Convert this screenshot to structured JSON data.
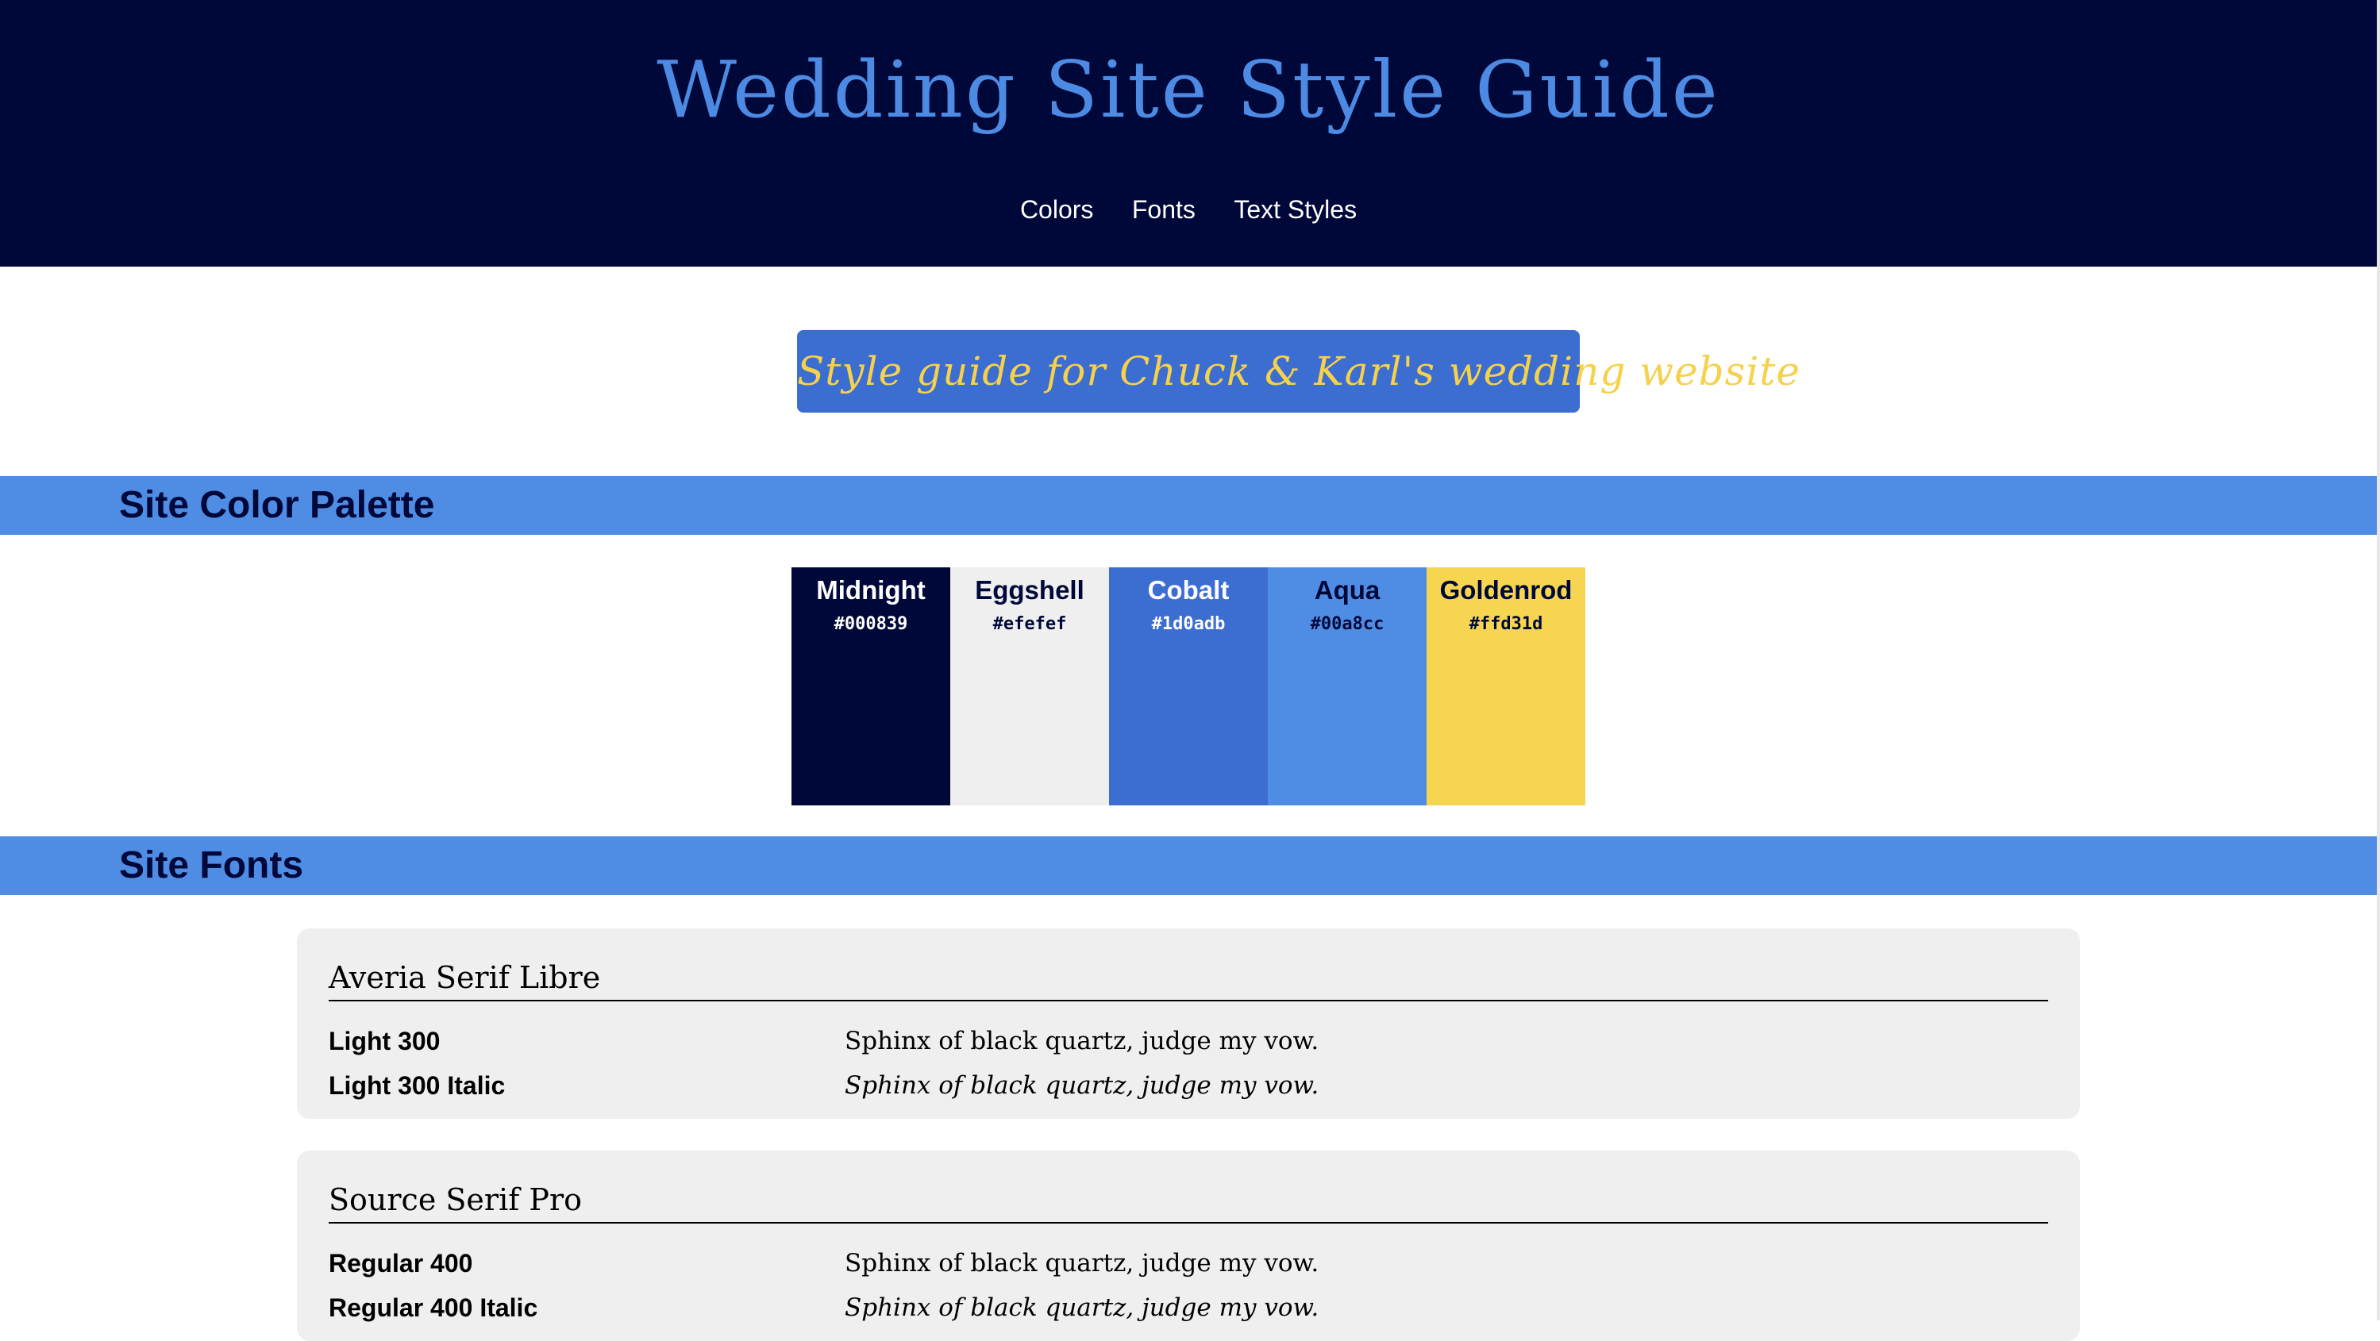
{
  "header": {
    "title": "Wedding Site Style Guide",
    "nav": [
      "Colors",
      "Fonts",
      "Text Styles"
    ]
  },
  "tagline": "Style guide for Chuck & Karl's wedding website",
  "sections": {
    "palette_title": "Site Color Palette",
    "fonts_title": "Site Fonts"
  },
  "palette": [
    {
      "name": "Midnight",
      "hex": "#000839",
      "text_color": "#ffffff"
    },
    {
      "name": "Eggshell",
      "hex": "#efefef",
      "text_color": "#000839"
    },
    {
      "name": "Cobalt",
      "hex": "#1d0adb",
      "text_color": "#ffffff"
    },
    {
      "name": "Aqua",
      "hex": "#00a8cc",
      "text_color": "#000839"
    },
    {
      "name": "Goldenrod",
      "hex": "#ffd31d",
      "text_color": "#000839"
    }
  ],
  "swatch_display_colors": [
    "#000839",
    "#efefef",
    "#3c6dd0",
    "#4f8ce4",
    "#f6d650"
  ],
  "fonts": [
    {
      "family": "Averia Serif Libre",
      "styles": [
        {
          "label": "Light 300",
          "sample": "Sphinx of black quartz, judge my vow.",
          "italic": false
        },
        {
          "label": "Light 300 Italic",
          "sample": "Sphinx of black quartz, judge my vow.",
          "italic": true
        }
      ]
    },
    {
      "family": "Source Serif Pro",
      "styles": [
        {
          "label": "Regular 400",
          "sample": "Sphinx of black quartz, judge my vow.",
          "italic": false
        },
        {
          "label": "Regular 400 Italic",
          "sample": "Sphinx of black quartz, judge my vow.",
          "italic": true
        }
      ]
    }
  ],
  "colors": {
    "header_bg": "#000839",
    "title": "#4c8ae3",
    "section_bar": "#4f8ce4",
    "tagline_bg": "#3c6dd0",
    "tagline_text": "#f6d14c"
  }
}
